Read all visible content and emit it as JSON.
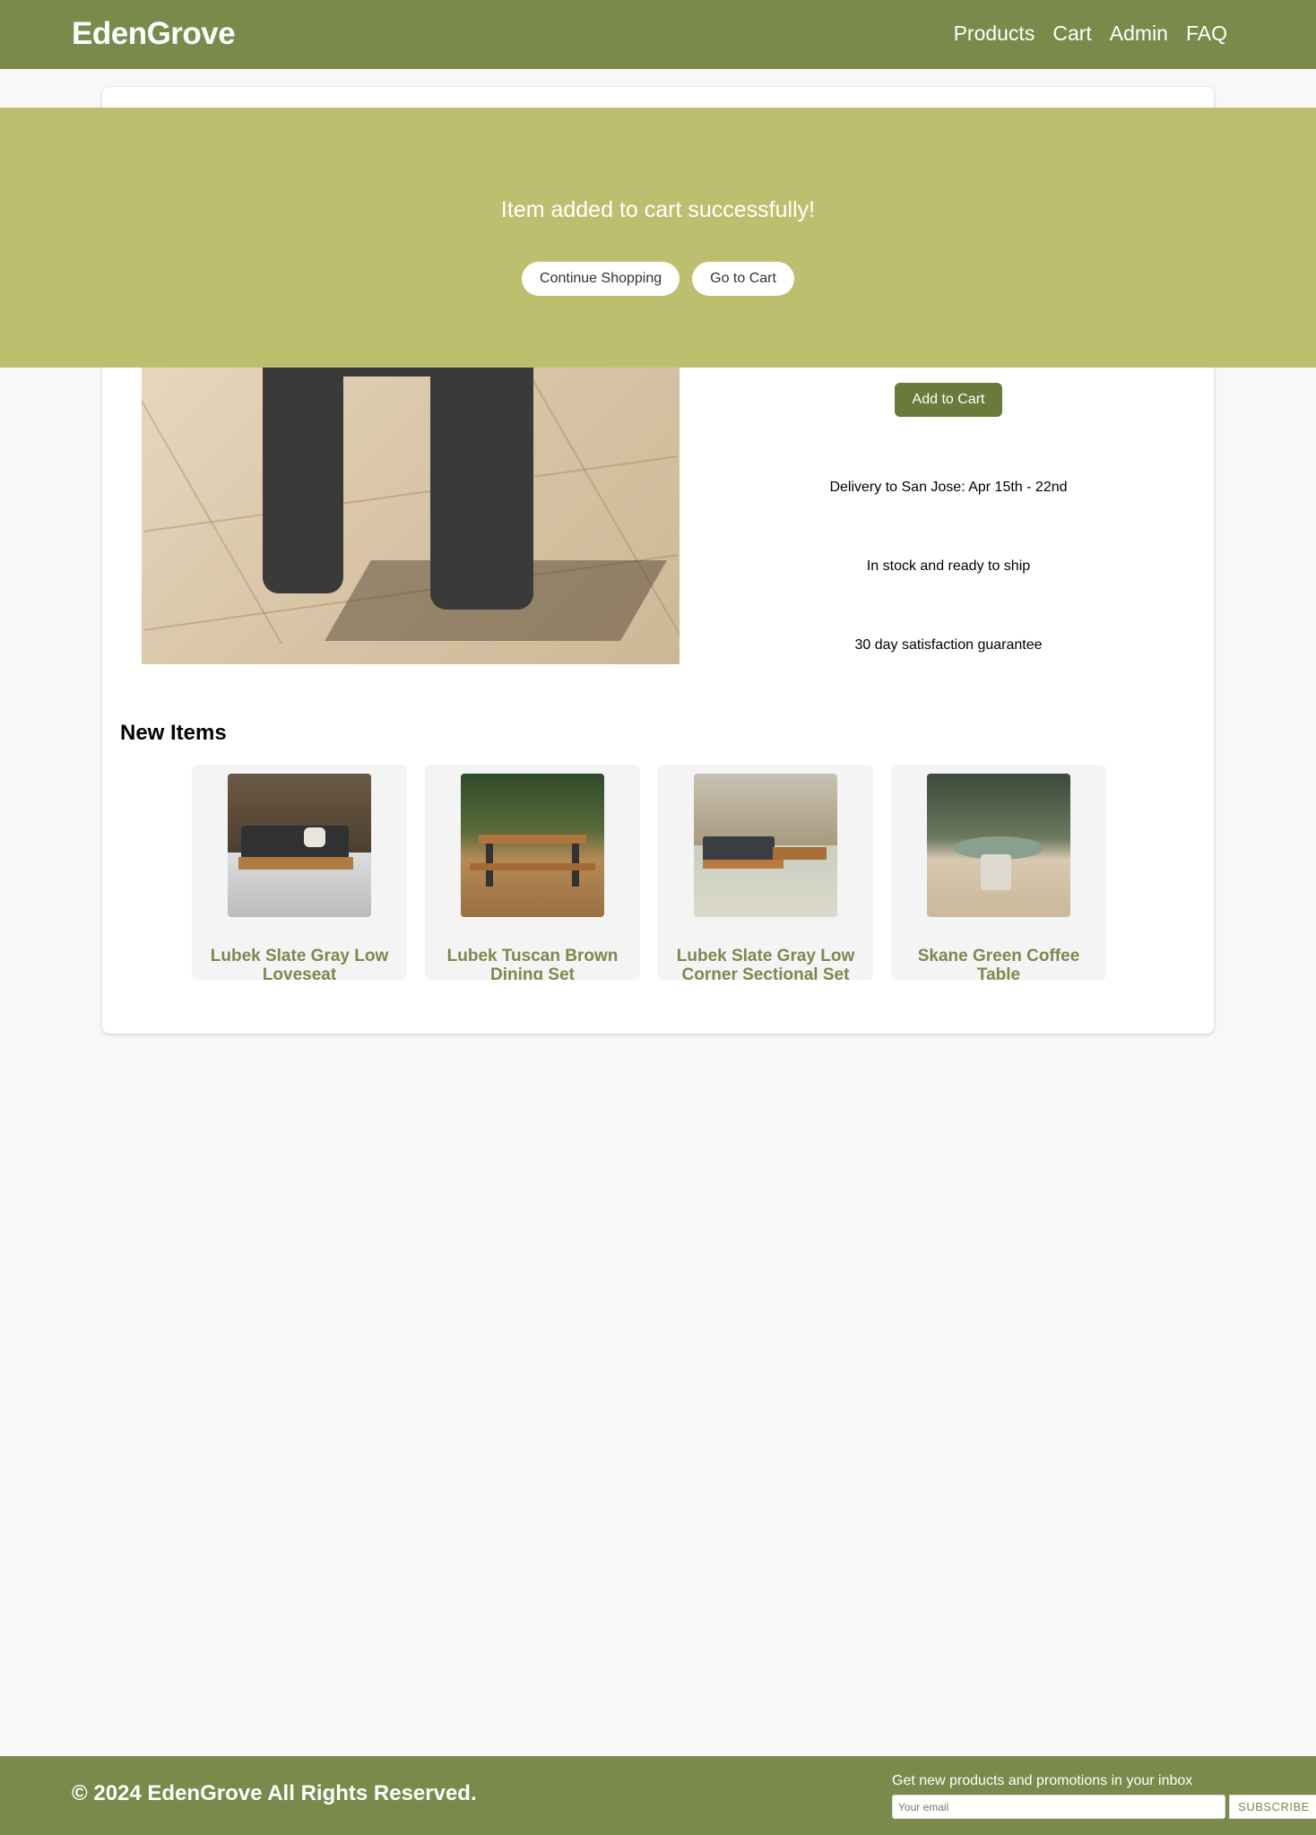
{
  "header": {
    "brand": "EdenGrove",
    "nav": [
      "Products",
      "Cart",
      "Admin",
      "FAQ"
    ]
  },
  "modal": {
    "message": "Item added to cart successfully!",
    "continue_label": "Continue Shopping",
    "cart_label": "Go to Cart"
  },
  "product": {
    "add_to_cart_label": "Add to Cart",
    "info": [
      "Delivery to San Jose: Apr 15th - 22nd",
      "In stock and ready to ship",
      "30 day satisfaction guarantee"
    ]
  },
  "new_items": {
    "title": "New Items",
    "items": [
      {
        "name": "Lubek Slate Gray Low Loveseat"
      },
      {
        "name": "Lubek Tuscan Brown Dining Set"
      },
      {
        "name": "Lubek Slate Gray Low Corner Sectional Set"
      },
      {
        "name": "Skane Green Coffee Table"
      }
    ]
  },
  "footer": {
    "copyright": "© 2024 EdenGrove All Rights Reserved.",
    "subscribe_text": "Get new products and promotions in your inbox",
    "email_placeholder": "Your email",
    "subscribe_label": "SUBSCRIBE"
  },
  "colors": {
    "brand_green": "#7a8a4a",
    "button_green": "#6a7a3a",
    "overlay": "#bdbf6f"
  }
}
